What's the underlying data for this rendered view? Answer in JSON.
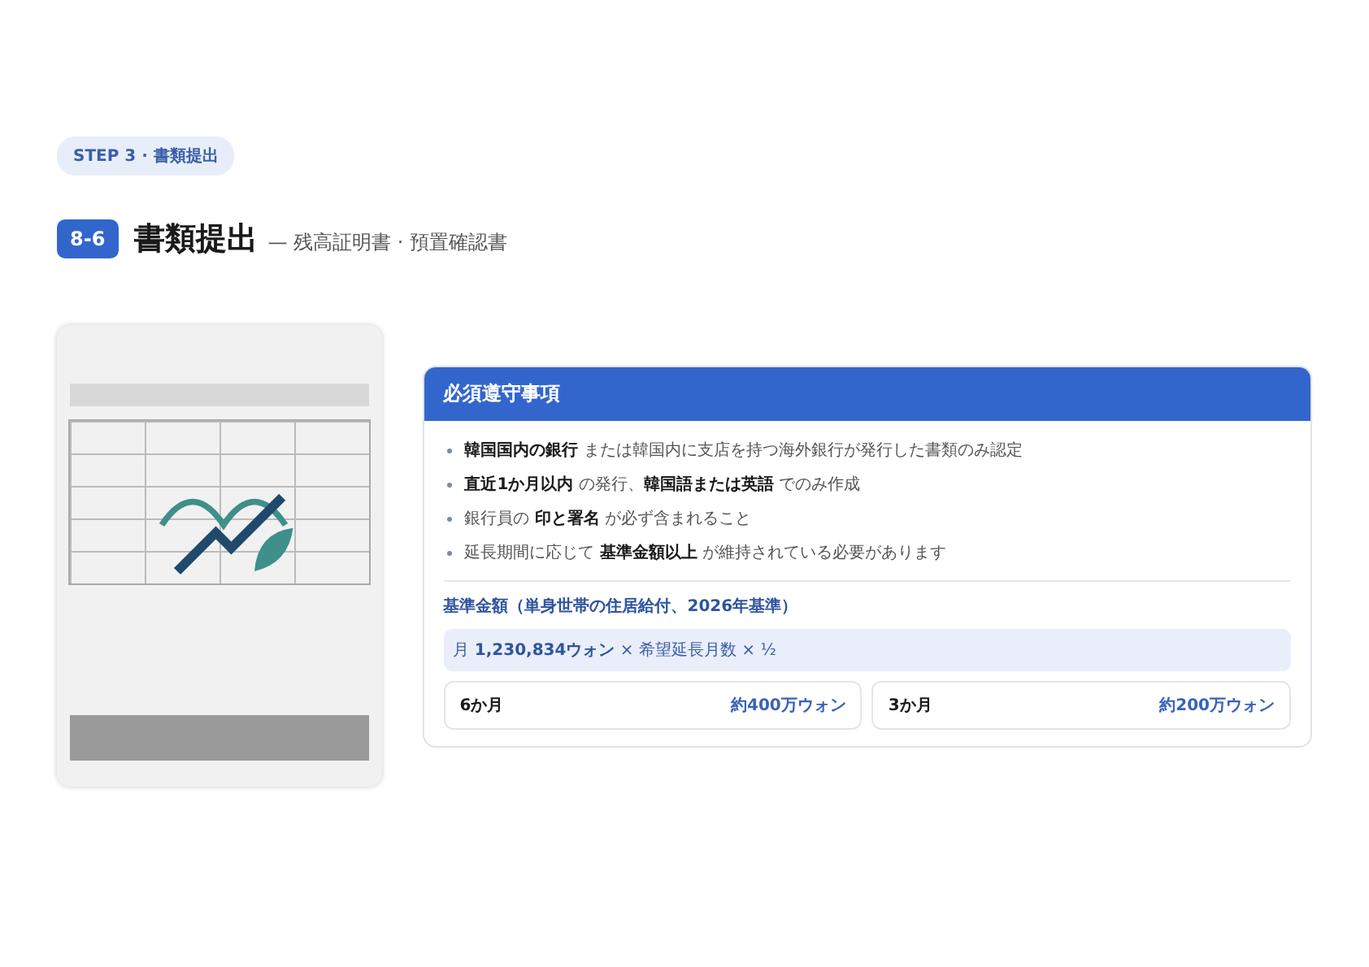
{
  "step_badge": "STEP 3 · 書類提出",
  "section": {
    "number": "8-6",
    "title": "書類提出",
    "subtitle": "— 残高証明書 · 預置確認書"
  },
  "notice": {
    "title": "必須遵守事項",
    "rules": [
      "**韓国国内の銀行** または韓国内に支店を持つ海外銀行が発行した書類のみ認定",
      "**直近1か月以内** の発行、**韓国語または英語** でのみ作成",
      "銀行員の **印と署名** が必ず含まれること",
      "延長期間に応じて **基準金額以上** が維持されている必要があります"
    ],
    "criteria_title": "基準金額（単身世帯の住居給付、2026年基準）",
    "formula": "月 **1,230,834ウォン** × 希望延長月数 × ½",
    "examples": [
      {
        "period": "6か月",
        "amount": "約400万ウォン"
      },
      {
        "period": "3か月",
        "amount": "約200万ウォン"
      }
    ]
  }
}
